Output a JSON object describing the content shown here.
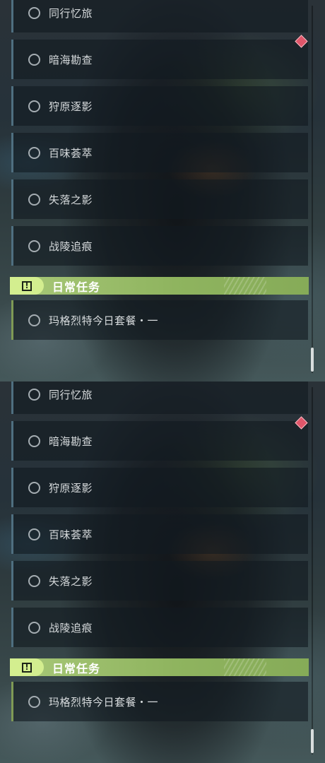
{
  "quests": [
    {
      "label": "同行忆旅"
    },
    {
      "label": "暗海勘查"
    },
    {
      "label": "狩原逐影"
    },
    {
      "label": "百味荟萃"
    },
    {
      "label": "失落之影"
    },
    {
      "label": "战陵追痕"
    }
  ],
  "daily_section": {
    "title": "日常任务",
    "icon": "exclamation-box-icon",
    "items": [
      {
        "label": "玛格烈特今日套餐・一"
      }
    ]
  },
  "colors": {
    "accent_green": "#a8c878",
    "alert_marker": "#e0566a"
  }
}
